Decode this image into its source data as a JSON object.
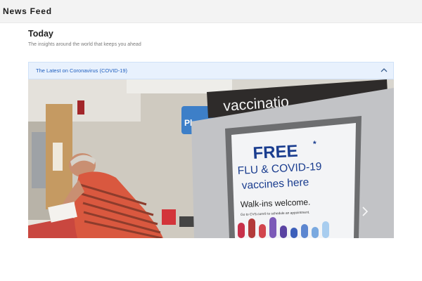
{
  "app": {
    "title": "News Feed"
  },
  "section": {
    "title": "Today",
    "subtitle": "The insights around the world that keeps you ahead"
  },
  "card": {
    "title": "The Latest on Coronavirus (COVID-19)",
    "collapse_icon": "chevron-up-icon",
    "next_icon": "chevron-right-icon",
    "image": {
      "top_sign": "vaccinatio",
      "blue_sign": "Ph",
      "poster_line1": "FREE",
      "poster_asterisk": "*",
      "poster_line2": "FLU & COVID-19",
      "poster_line3": "vaccines here",
      "poster_line4": "Walk-ins welcome.",
      "poster_line5": "Go to CVS.com® to schedule an appointment."
    }
  },
  "colors": {
    "header_bg": "#e8f1fd",
    "accent": "#1f5fbf",
    "poster_blue": "#1a3d8f",
    "sign_dark": "#2e2b2a"
  }
}
